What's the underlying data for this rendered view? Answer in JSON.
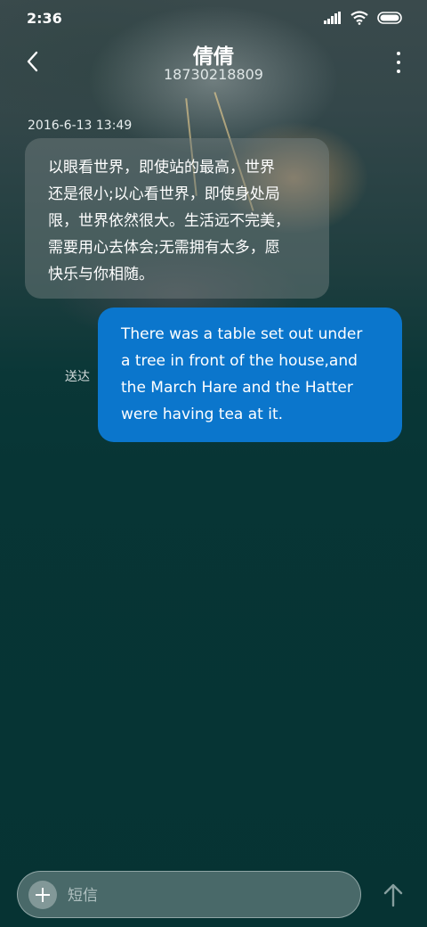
{
  "status_bar": {
    "time": "2:36",
    "icons": [
      "signal-icon",
      "wifi-icon",
      "battery-icon"
    ]
  },
  "header": {
    "contact_name": "倩倩",
    "contact_number": "18730218809",
    "back_icon": "chevron-left-icon",
    "more_icon": "more-vertical-icon"
  },
  "conversation": {
    "messages": [
      {
        "direction": "incoming",
        "timestamp": "2016-6-13 13:49",
        "lines": [
          "以眼看世界，即使站的最高，世界",
          "还是很小;以心看世界，即使身处局",
          "限，世界依然很大。生活远不完美，",
          "需要用心去体会;无需拥有太多，愿",
          "快乐与你相随。"
        ]
      },
      {
        "direction": "outgoing",
        "status": "送达",
        "lines": [
          "There was a table set out under",
          "a tree in front of the house,and",
          "the March Hare and the Hatter",
          "were having tea at it."
        ]
      }
    ]
  },
  "composer": {
    "placeholder": "短信",
    "value": "",
    "add_icon": "plus-icon",
    "send_icon": "arrow-up-icon"
  },
  "colors": {
    "background": "#073535",
    "outgoing_bubble": "#0b76cc",
    "incoming_bubble": "rgba(120,130,130,0.45)",
    "text": "#ffffff"
  }
}
